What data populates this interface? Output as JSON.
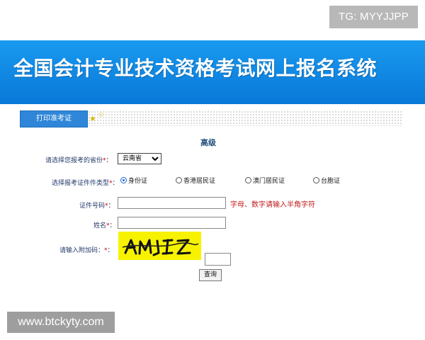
{
  "watermark_top": "TG: MYYJJPP",
  "watermark_bottom": "www.btckyty.com",
  "header": {
    "title": "全国会计专业技术资格考试网上报名系统"
  },
  "tabs": {
    "print_admission": "打印准考证"
  },
  "form": {
    "title": "高级",
    "province_label": "请选择您报考的省份",
    "province_value": "云南省",
    "id_type_label": "选择报考证件件类型",
    "id_types": [
      "身份证",
      "香港居民证",
      "澳门居民证",
      "台胞证"
    ],
    "selected_id_type": "身份证",
    "id_number_label": "证件号码",
    "id_number_hint": "字母、数字请输入半角字符",
    "name_label": "姓名",
    "captcha_label": "请输入附加码",
    "captcha_text": "AMJEZ",
    "required_mark": "*",
    "colon": "：",
    "query_button": "查询"
  },
  "colors": {
    "header_blue": "#0a86e3",
    "tab_blue": "#2f86d8",
    "captcha_yellow": "#f7f200",
    "hint_red": "#c0191c"
  }
}
